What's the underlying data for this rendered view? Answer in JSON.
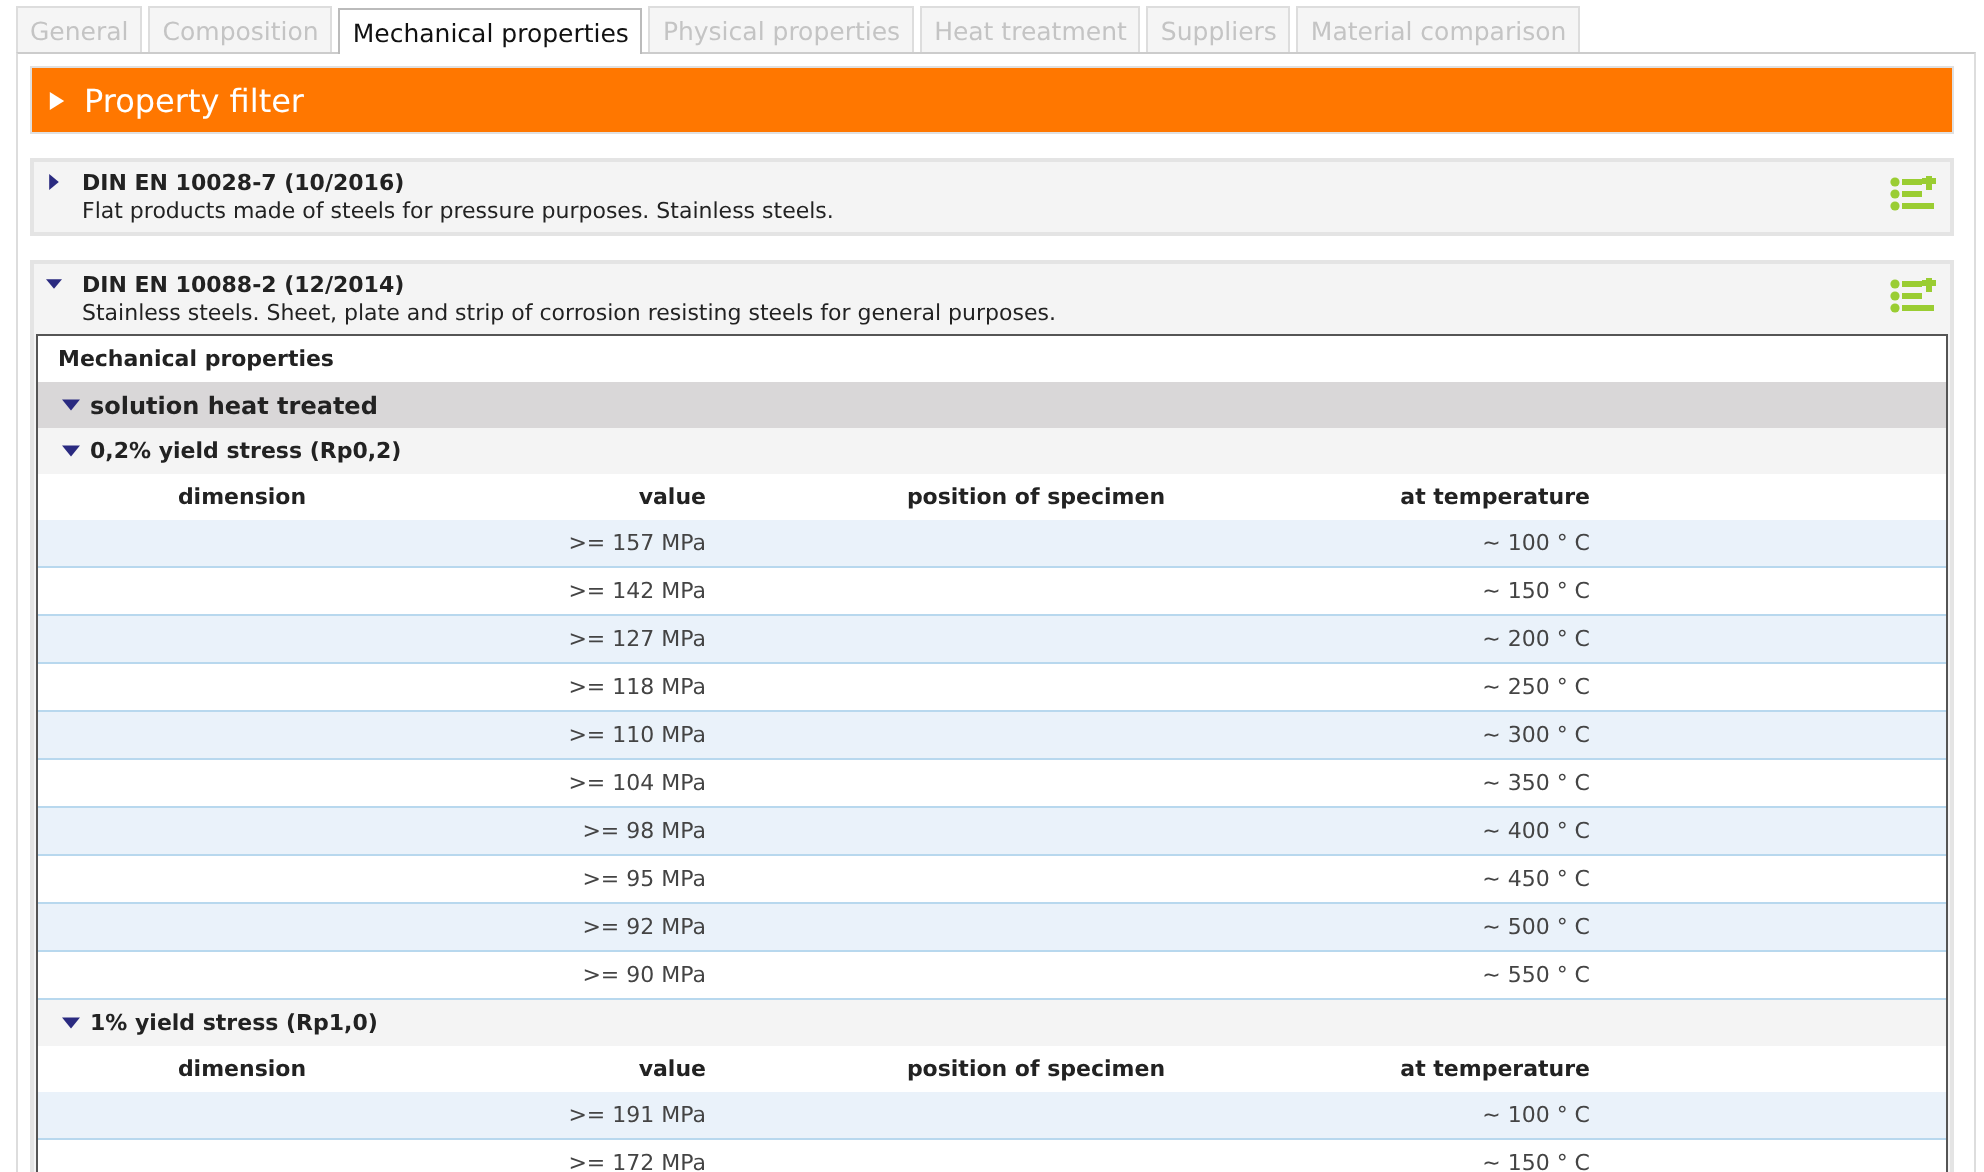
{
  "tabs": [
    {
      "label": "General",
      "selected": false
    },
    {
      "label": "Composition",
      "selected": false
    },
    {
      "label": "Mechanical properties",
      "selected": true
    },
    {
      "label": "Physical properties",
      "selected": false
    },
    {
      "label": "Heat treatment",
      "selected": false
    },
    {
      "label": "Suppliers",
      "selected": false
    },
    {
      "label": "Material comparison",
      "selected": false
    }
  ],
  "filter": {
    "label": "Property filter",
    "expanded": false
  },
  "standards": [
    {
      "title": "DIN EN 10028-7 (10/2016)",
      "description": "Flat products made of steels for pressure purposes. Stainless steels.",
      "expanded": false
    },
    {
      "title": "DIN EN 10088-2 (12/2014)",
      "description": "Stainless steels. Sheet, plate and strip of corrosion resisting steels for general purposes.",
      "expanded": true,
      "table": {
        "title": "Mechanical properties",
        "groups": [
          {
            "label": "solution heat treated",
            "expanded": true,
            "properties": [
              {
                "label": "0,2% yield stress (Rp0,2)",
                "expanded": true,
                "columns": [
                  "dimension",
                  "value",
                  "position of specimen",
                  "at temperature"
                ],
                "rows": [
                  {
                    "value": ">= 157 MPa",
                    "temperature": "~ 100 ° C"
                  },
                  {
                    "value": ">= 142 MPa",
                    "temperature": "~ 150 ° C"
                  },
                  {
                    "value": ">= 127 MPa",
                    "temperature": "~ 200 ° C"
                  },
                  {
                    "value": ">= 118 MPa",
                    "temperature": "~ 250 ° C"
                  },
                  {
                    "value": ">= 110 MPa",
                    "temperature": "~ 300 ° C"
                  },
                  {
                    "value": ">= 104 MPa",
                    "temperature": "~ 350 ° C"
                  },
                  {
                    "value": ">= 98 MPa",
                    "temperature": "~ 400 ° C"
                  },
                  {
                    "value": ">= 95 MPa",
                    "temperature": "~ 450 ° C"
                  },
                  {
                    "value": ">= 92 MPa",
                    "temperature": "~ 500 ° C"
                  },
                  {
                    "value": ">= 90 MPa",
                    "temperature": "~ 550 ° C"
                  }
                ]
              },
              {
                "label": "1% yield stress (Rp1,0)",
                "expanded": true,
                "columns": [
                  "dimension",
                  "value",
                  "position of specimen",
                  "at temperature"
                ],
                "rows": [
                  {
                    "value": ">= 191 MPa",
                    "temperature": "~ 100 ° C"
                  },
                  {
                    "value": ">= 172 MPa",
                    "temperature": "~ 150 ° C"
                  }
                ]
              }
            ]
          }
        ]
      }
    }
  ]
}
